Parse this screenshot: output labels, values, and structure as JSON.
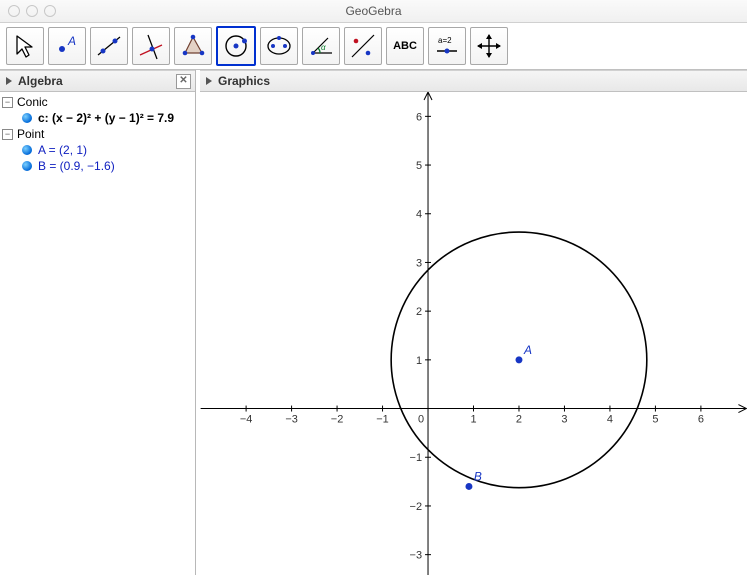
{
  "app": {
    "title": "GeoGebra"
  },
  "toolbar": {
    "selected_index": 5,
    "tools": [
      "move-tool",
      "point-tool",
      "line-tool",
      "perpendicular-tool",
      "polygon-tool",
      "circle-tool",
      "ellipse-tool",
      "angle-tool",
      "reflect-tool",
      "text-tool",
      "slider-tool",
      "move-view-tool"
    ],
    "text_tool_label": "ABC",
    "slider_tool_label": "a=2"
  },
  "panels": {
    "algebra_title": "Algebra",
    "graphics_title": "Graphics"
  },
  "algebra": {
    "groups": [
      {
        "name": "Conic",
        "items": [
          {
            "kind": "obj",
            "text": "c: (x − 2)² + (y − 1)² = 7.9"
          }
        ]
      },
      {
        "name": "Point",
        "items": [
          {
            "kind": "pt",
            "text": "A = (2, 1)"
          },
          {
            "kind": "pt",
            "text": "B = (0.9, −1.6)"
          }
        ]
      }
    ]
  },
  "chart_data": {
    "type": "scatter",
    "title": "",
    "xlabel": "",
    "ylabel": "",
    "xlim": [
      -5,
      7
    ],
    "ylim": [
      -3.5,
      6.5
    ],
    "xticks": [
      -4,
      -3,
      -2,
      -1,
      0,
      1,
      2,
      3,
      4,
      5,
      6
    ],
    "yticks": [
      -3,
      -2,
      -1,
      0,
      1,
      2,
      3,
      4,
      5,
      6
    ],
    "series": [
      {
        "name": "A",
        "x": [
          2
        ],
        "y": [
          1
        ]
      },
      {
        "name": "B",
        "x": [
          0.9
        ],
        "y": [
          -1.6
        ]
      }
    ],
    "circle": {
      "cx": 2,
      "cy": 1,
      "r_squared": 7.9
    }
  }
}
